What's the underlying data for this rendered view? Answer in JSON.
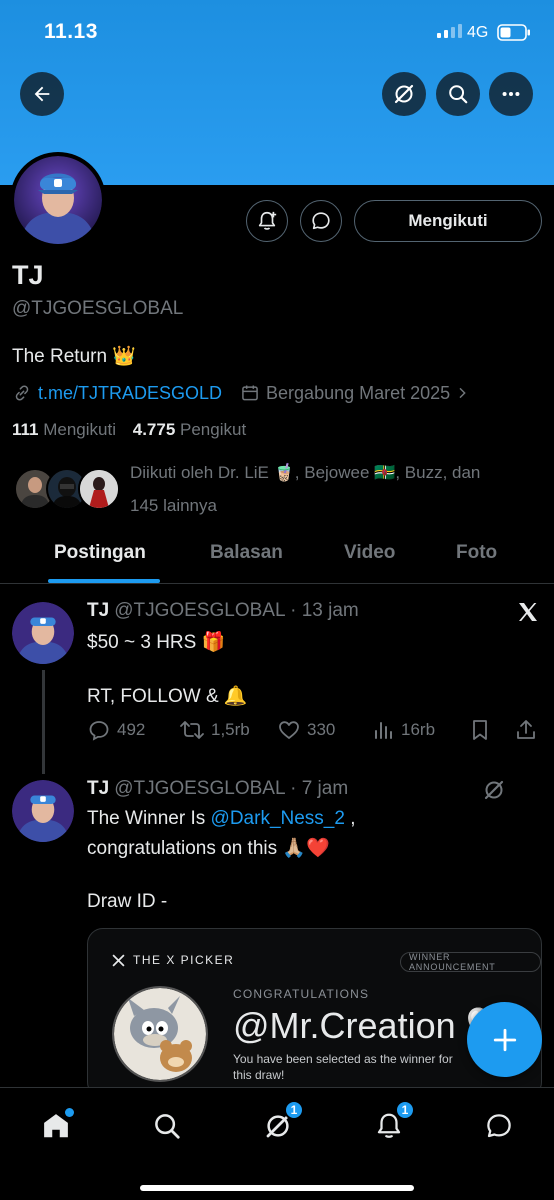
{
  "status_bar": {
    "time": "11.13",
    "network": "4G"
  },
  "profile": {
    "name": "TJ",
    "handle": "@TJGOESGLOBAL",
    "bio": "The Return 👑",
    "link": "t.me/TJTRADESGOLD",
    "joined": "Bergabung Maret 2025",
    "following_count": "111",
    "following_label": "Mengikuti",
    "followers_count": "4.775",
    "followers_label": "Pengikut",
    "followed_by_line1": "Diikuti oleh Dr. LiE 🧋, Bejowee 🇩🇲, Buzz, dan",
    "followed_by_line2": "145 lainnya",
    "follow_button_label": "Mengikuti"
  },
  "tabs": [
    "Postingan",
    "Balasan",
    "Video",
    "Foto"
  ],
  "posts": [
    {
      "author": "TJ",
      "handle": "@TJGOESGLOBAL",
      "time": "· 13 jam",
      "line1": "$50 ~ 3 HRS 🎁",
      "line2": "RT, FOLLOW & 🔔",
      "replies": "492",
      "reposts": "1,5rb",
      "likes": "330",
      "views": "16rb"
    },
    {
      "author": "TJ",
      "handle": "@TJGOESGLOBAL",
      "time": "· 7 jam",
      "line1_prefix": "The Winner Is",
      "mention": "@Dark_Ness_2",
      "line1_suffix": " ,",
      "line2": "congratulations on this 🙏🏼❤️",
      "line3": "Draw ID -",
      "card": {
        "brand": "THE X PICKER",
        "badge": "WINNER ANNOUNCEMENT",
        "congrats": "CONGRATULATIONS",
        "winner": "@Mr.Creation 🤍",
        "subtitle": "You have been selected as the winner for this draw!"
      }
    }
  ],
  "bottom_nav": {
    "spaces_badge": "1",
    "notifications_badge": "1"
  },
  "colors": {
    "accent": "#1d9bf0",
    "banner": "#2a9df0",
    "background": "#000000"
  },
  "icons": [
    "back-arrow-icon",
    "grok-icon",
    "search-icon",
    "more-icon",
    "bell-plus-icon",
    "message-icon",
    "link-icon",
    "calendar-icon",
    "x-logo-icon",
    "reply-icon",
    "repost-icon",
    "like-icon",
    "views-icon",
    "bookmark-icon",
    "share-icon",
    "home-icon",
    "explore-icon",
    "spaces-icon",
    "notifications-icon",
    "messages-icon",
    "compose-icon"
  ]
}
